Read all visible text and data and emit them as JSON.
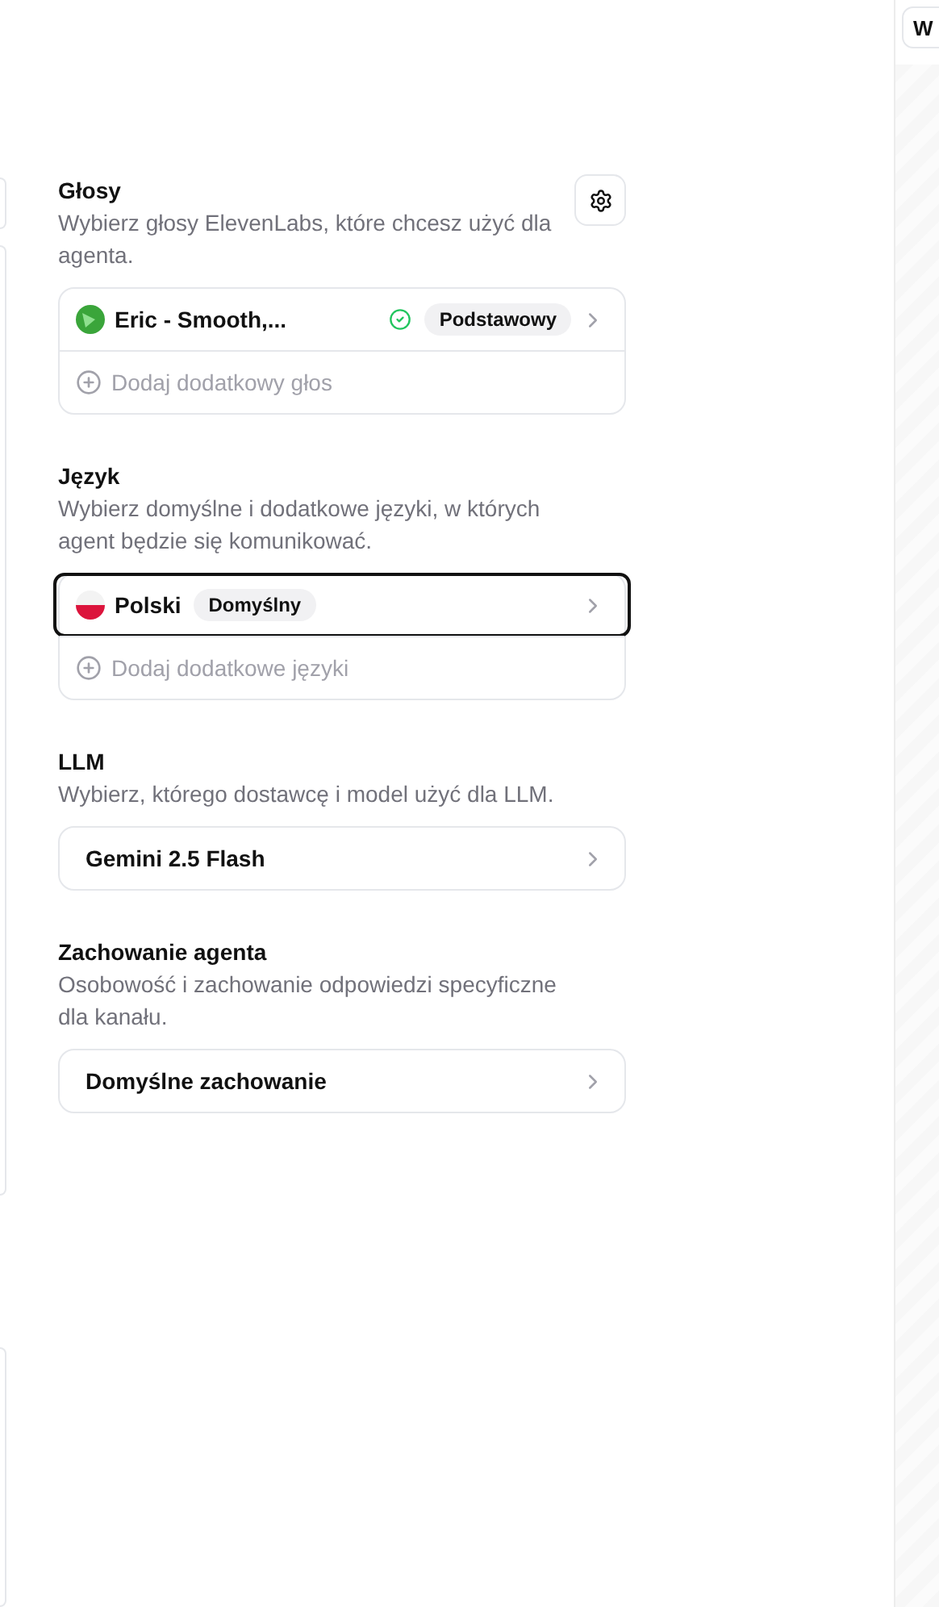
{
  "top_button": {
    "label": "W"
  },
  "sections": [
    {
      "kind": "list",
      "title": "Głosy",
      "description": "Wybierz głosy ElevenLabs, które chcesz użyć dla agenta.",
      "settings": true,
      "items": [
        {
          "kind": "voice",
          "name": "Eric - Smooth,...",
          "verified": true,
          "badge": "Podstawowy",
          "focused": false
        }
      ],
      "add_label": "Dodaj dodatkowy głos"
    },
    {
      "kind": "list",
      "title": "Język",
      "description": "Wybierz domyślne i dodatkowe języki, w których agent będzie się komunikować.",
      "items": [
        {
          "kind": "language",
          "name": "Polski",
          "verified": false,
          "badge": "Domyślny",
          "focused": true
        }
      ],
      "add_label": "Dodaj dodatkowe języki"
    },
    {
      "kind": "select",
      "title": "LLM",
      "description": "Wybierz, którego dostawcę i model użyć dla LLM.",
      "value": "Gemini 2.5 Flash"
    },
    {
      "kind": "select",
      "title": "Zachowanie agenta",
      "description": "Osobowość i zachowanie odpowiedzi specyficzne dla kanału.",
      "value": "Domyślne zachowanie"
    }
  ]
}
